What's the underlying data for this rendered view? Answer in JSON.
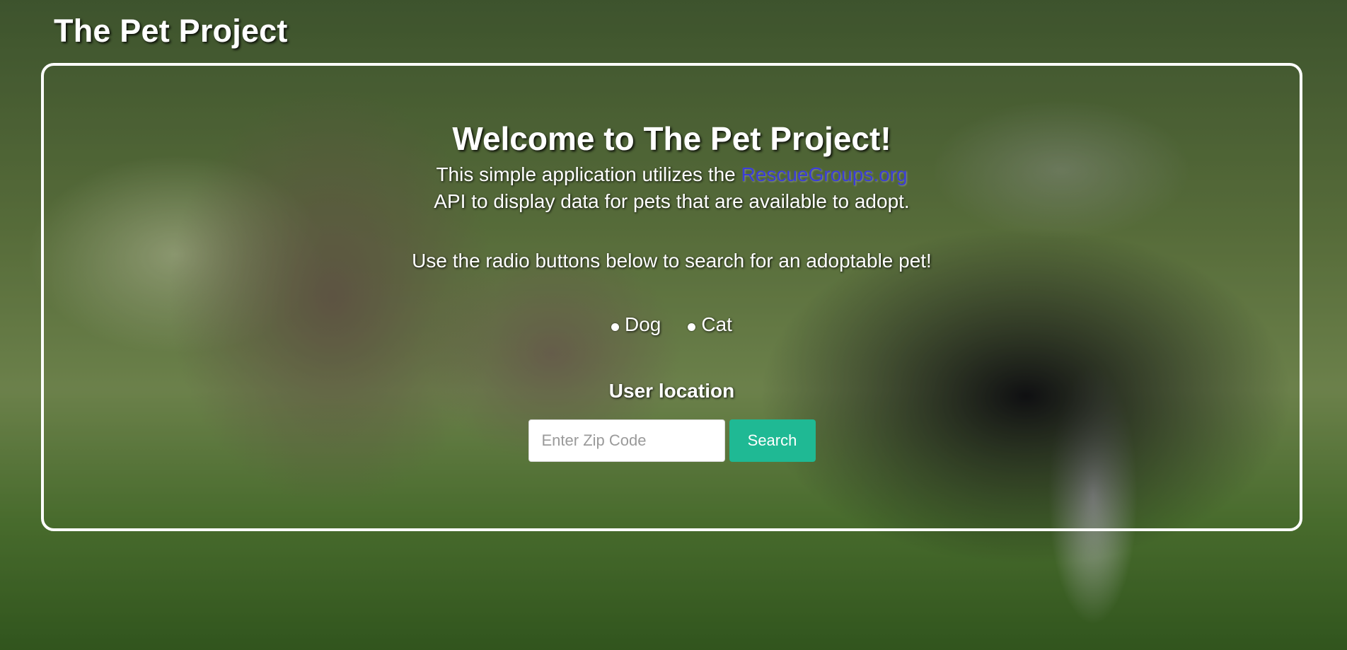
{
  "header": {
    "brand": "The Pet Project"
  },
  "main": {
    "welcome_title": "Welcome to The Pet Project!",
    "intro_before_link": "This simple application utilizes the ",
    "intro_link": "RescueGroups.org",
    "intro_after_link": "API to display data for pets that are available to adopt.",
    "instructions": "Use the radio buttons below to search for an adoptable pet!",
    "radio_options": [
      {
        "label": "Dog"
      },
      {
        "label": "Cat"
      }
    ],
    "location_label": "User location",
    "zip_placeholder": "Enter Zip Code",
    "search_label": "Search"
  },
  "colors": {
    "link": "#3b3dd6",
    "search_button": "#1fb994",
    "panel_border": "#ffffff"
  }
}
